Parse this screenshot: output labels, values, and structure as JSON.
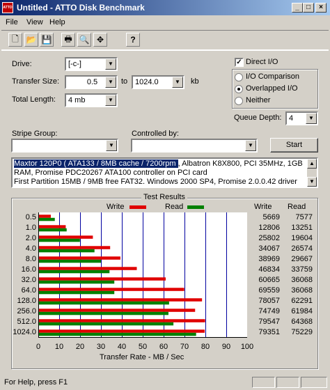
{
  "window": {
    "title": "Untitled - ATTO Disk Benchmark",
    "icon_text": "ATTO"
  },
  "title_buttons": {
    "minimize": "_",
    "maximize": "□",
    "close": "×"
  },
  "menu": [
    "File",
    "View",
    "Help"
  ],
  "toolbar": [
    {
      "name": "new-icon",
      "glyph": "🗋"
    },
    {
      "name": "open-icon",
      "glyph": "📂"
    },
    {
      "name": "save-icon",
      "glyph": "💾"
    },
    {
      "name": "print-icon",
      "glyph": "🖶"
    },
    {
      "name": "print-preview-icon",
      "glyph": "🔍"
    },
    {
      "name": "move-icon",
      "glyph": "✥"
    },
    {
      "name": "help-icon",
      "glyph": "?"
    }
  ],
  "form": {
    "drive_label": "Drive:",
    "drive_value": "[-c-]",
    "transfer_label": "Transfer Size:",
    "transfer_from": "0.5",
    "to_label": "to",
    "transfer_to": "1024.0",
    "kb_label": "kb",
    "length_label": "Total Length:",
    "length_value": "4 mb",
    "stripe_label": "Stripe Group:",
    "stripe_value": "",
    "controlled_label": "Controlled by:",
    "controlled_value": "",
    "start_label": "Start",
    "direct_io_label": "Direct I/O",
    "direct_io_checked": true,
    "io_options": [
      {
        "label": "I/O Comparison",
        "selected": false
      },
      {
        "label": "Overlapped I/O",
        "selected": true
      },
      {
        "label": "Neither",
        "selected": false
      }
    ],
    "queue_label": "Queue Depth:",
    "queue_value": "4"
  },
  "description": {
    "line1_highlight": "Maxtor 120P0 ( ATA133 / 8MB cache / 7200rpm ",
    "line1_rest": ", Albatron K8X800, PCI 35MHz, 1GB",
    "line2": "RAM, Promise PDC20267 ATA100 controller on PCI card",
    "line3": "First Partition 15MB / 9MB free FAT32. Windows 2000 SP4, Promise 2.0.0.42 driver"
  },
  "results": {
    "group_title": "Test Results",
    "write_legend": "Write",
    "read_legend": "Read",
    "write_col": "Write",
    "read_col": "Read",
    "xlabel": "Transfer Rate - MB / Sec",
    "colors": {
      "write": "#e00000",
      "read": "#008000",
      "grid": "#0000a0"
    }
  },
  "chart_data": {
    "type": "bar",
    "categories": [
      "0.5",
      "1.0",
      "2.0",
      "4.0",
      "8.0",
      "16.0",
      "32.0",
      "64.0",
      "128.0",
      "256.0",
      "512.0",
      "1024.0"
    ],
    "series": [
      {
        "name": "Write",
        "values": [
          5669,
          12806,
          25802,
          34067,
          38969,
          46834,
          60665,
          69559,
          78057,
          74749,
          79547,
          79351
        ]
      },
      {
        "name": "Read",
        "values": [
          7577,
          13251,
          19604,
          26574,
          29667,
          33759,
          36068,
          36068,
          62291,
          61984,
          64368,
          75229
        ]
      }
    ],
    "xticks": [
      "0",
      "10",
      "20",
      "30",
      "40",
      "50",
      "60",
      "70",
      "80",
      "90",
      "100"
    ],
    "xlim": [
      0,
      100
    ],
    "xlabel": "Transfer Rate - MB / Sec",
    "grid": true
  },
  "status": {
    "text": "For Help, press F1"
  }
}
